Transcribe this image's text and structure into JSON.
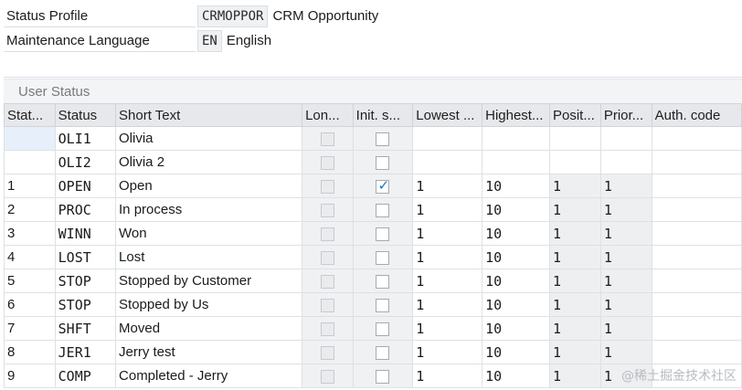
{
  "header": {
    "status_profile": {
      "label": "Status Profile",
      "code": "CRMOPPOR",
      "desc": "CRM Opportunity"
    },
    "maintenance_language": {
      "label": "Maintenance Language",
      "code": "EN",
      "desc": "English"
    }
  },
  "section": {
    "title": "User Status"
  },
  "table": {
    "columns": [
      "Stat...",
      "Status",
      "Short Text",
      "Lon...",
      "Init. s...",
      "Lowest ...",
      "Highest...",
      "Posit...",
      "Prior...",
      "Auth. code"
    ],
    "rows": [
      {
        "num": "",
        "status": "OLI1",
        "text": "Olivia",
        "initial": false,
        "lowest": "",
        "highest": "",
        "pos": "",
        "prior": "",
        "auth": ""
      },
      {
        "num": "",
        "status": "OLI2",
        "text": "Olivia 2",
        "initial": false,
        "lowest": "",
        "highest": "",
        "pos": "",
        "prior": "",
        "auth": ""
      },
      {
        "num": "1",
        "status": "OPEN",
        "text": "Open",
        "initial": true,
        "lowest": "1",
        "highest": "10",
        "pos": "1",
        "prior": "1",
        "auth": ""
      },
      {
        "num": "2",
        "status": "PROC",
        "text": "In process",
        "initial": false,
        "lowest": "1",
        "highest": "10",
        "pos": "1",
        "prior": "1",
        "auth": ""
      },
      {
        "num": "3",
        "status": "WINN",
        "text": "Won",
        "initial": false,
        "lowest": "1",
        "highest": "10",
        "pos": "1",
        "prior": "1",
        "auth": ""
      },
      {
        "num": "4",
        "status": "LOST",
        "text": "Lost",
        "initial": false,
        "lowest": "1",
        "highest": "10",
        "pos": "1",
        "prior": "1",
        "auth": ""
      },
      {
        "num": "5",
        "status": "STOP",
        "text": "Stopped by Customer",
        "initial": false,
        "lowest": "1",
        "highest": "10",
        "pos": "1",
        "prior": "1",
        "auth": ""
      },
      {
        "num": "6",
        "status": "STOP",
        "text": "Stopped by Us",
        "initial": false,
        "lowest": "1",
        "highest": "10",
        "pos": "1",
        "prior": "1",
        "auth": ""
      },
      {
        "num": "7",
        "status": "SHFT",
        "text": "Moved",
        "initial": false,
        "lowest": "1",
        "highest": "10",
        "pos": "1",
        "prior": "1",
        "auth": ""
      },
      {
        "num": "8",
        "status": "JER1",
        "text": "Jerry test",
        "initial": false,
        "lowest": "1",
        "highest": "10",
        "pos": "1",
        "prior": "1",
        "auth": ""
      },
      {
        "num": "9",
        "status": "COMP",
        "text": "Completed - Jerry",
        "initial": false,
        "lowest": "1",
        "highest": "10",
        "pos": "1",
        "prior": "1",
        "auth": ""
      }
    ]
  },
  "watermark": "@稀土掘金技术社区"
}
